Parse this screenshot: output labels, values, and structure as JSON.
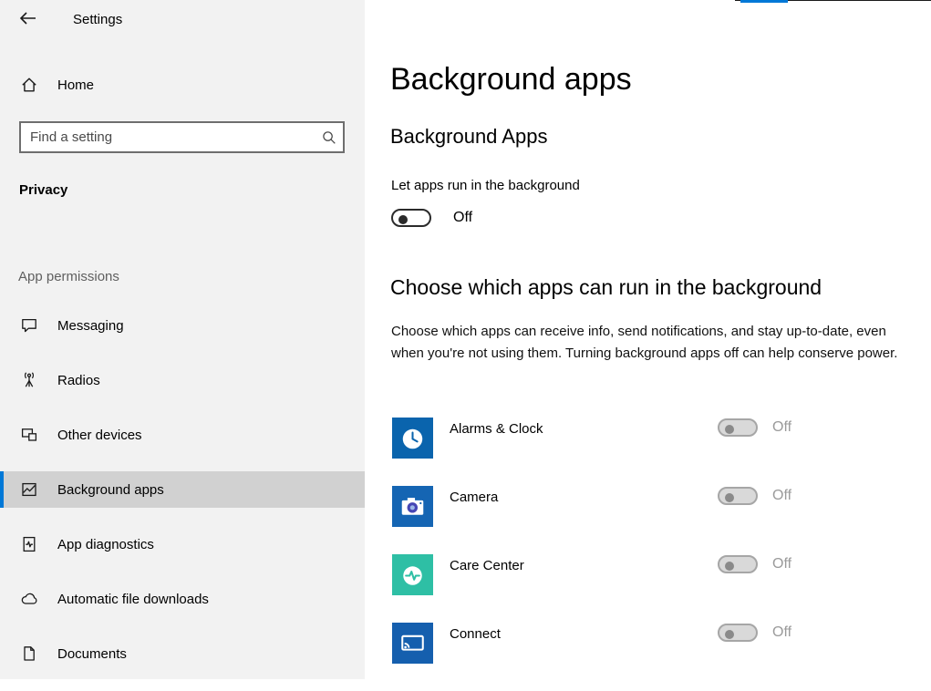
{
  "colors": {
    "accent": "#0078d7",
    "sidebar_bg": "#f2f2f2",
    "selected_bg": "#d1d1d1",
    "disabled_text": "#9a9a9a"
  },
  "window": {
    "title": "Settings"
  },
  "sidebar": {
    "home_label": "Home",
    "search_placeholder": "Find a setting",
    "section_title": "Privacy",
    "group_label": "App permissions",
    "items": [
      {
        "label": "Messaging",
        "selected": false
      },
      {
        "label": "Radios",
        "selected": false
      },
      {
        "label": "Other devices",
        "selected": false
      },
      {
        "label": "Background apps",
        "selected": true
      },
      {
        "label": "App diagnostics",
        "selected": false
      },
      {
        "label": "Automatic file downloads",
        "selected": false
      },
      {
        "label": "Documents",
        "selected": false
      }
    ]
  },
  "main": {
    "page_title": "Background apps",
    "section1": {
      "heading": "Background Apps",
      "toggle_label": "Let apps run in the background",
      "toggle_state": "Off"
    },
    "section2": {
      "heading": "Choose which apps can run in the background",
      "description": "Choose which apps can receive info, send notifications, and stay up-to-date, even when you're not using them. Turning background apps off can help conserve power.",
      "apps": [
        {
          "name": "Alarms & Clock",
          "state": "Off",
          "tile_color": "#0a64ad"
        },
        {
          "name": "Camera",
          "state": "Off",
          "tile_color": "#1565b3"
        },
        {
          "name": "Care Center",
          "state": "Off",
          "tile_color": "#2ebfa5"
        },
        {
          "name": "Connect",
          "state": "Off",
          "tile_color": "#155fae"
        }
      ]
    }
  }
}
